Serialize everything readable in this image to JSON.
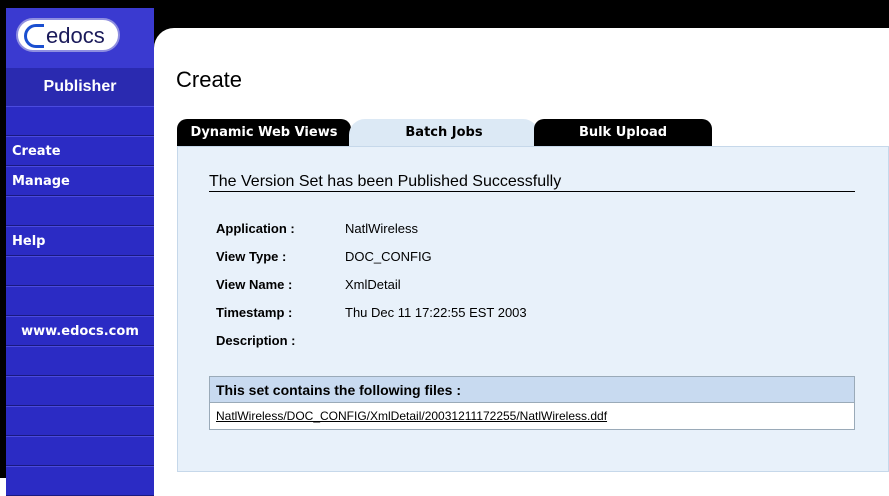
{
  "sidebar": {
    "logo_text": "edocs",
    "product": "Publisher",
    "items": [
      {
        "label": "Create"
      },
      {
        "label": "Manage"
      },
      {
        "label": "Help"
      },
      {
        "label": "www.edocs.com"
      }
    ]
  },
  "page": {
    "title": "Create"
  },
  "tabs": [
    {
      "label": "Dynamic Web Views",
      "active": false
    },
    {
      "label": "Batch Jobs",
      "active": true
    },
    {
      "label": "Bulk Upload",
      "active": false
    }
  ],
  "result": {
    "heading": "The Version Set has been Published Successfully",
    "fields": [
      {
        "label": "Application :",
        "value": "NatlWireless"
      },
      {
        "label": "View Type :",
        "value": "DOC_CONFIG"
      },
      {
        "label": "View Name :",
        "value": "XmlDetail"
      },
      {
        "label": "Timestamp :",
        "value": "Thu Dec 11 17:22:55 EST 2003"
      },
      {
        "label": "Description :",
        "value": ""
      }
    ]
  },
  "files": {
    "header": "This set contains the following files :",
    "items": [
      "NatlWireless/DOC_CONFIG/XmlDetail/20031211172255/NatlWireless.ddf"
    ]
  }
}
